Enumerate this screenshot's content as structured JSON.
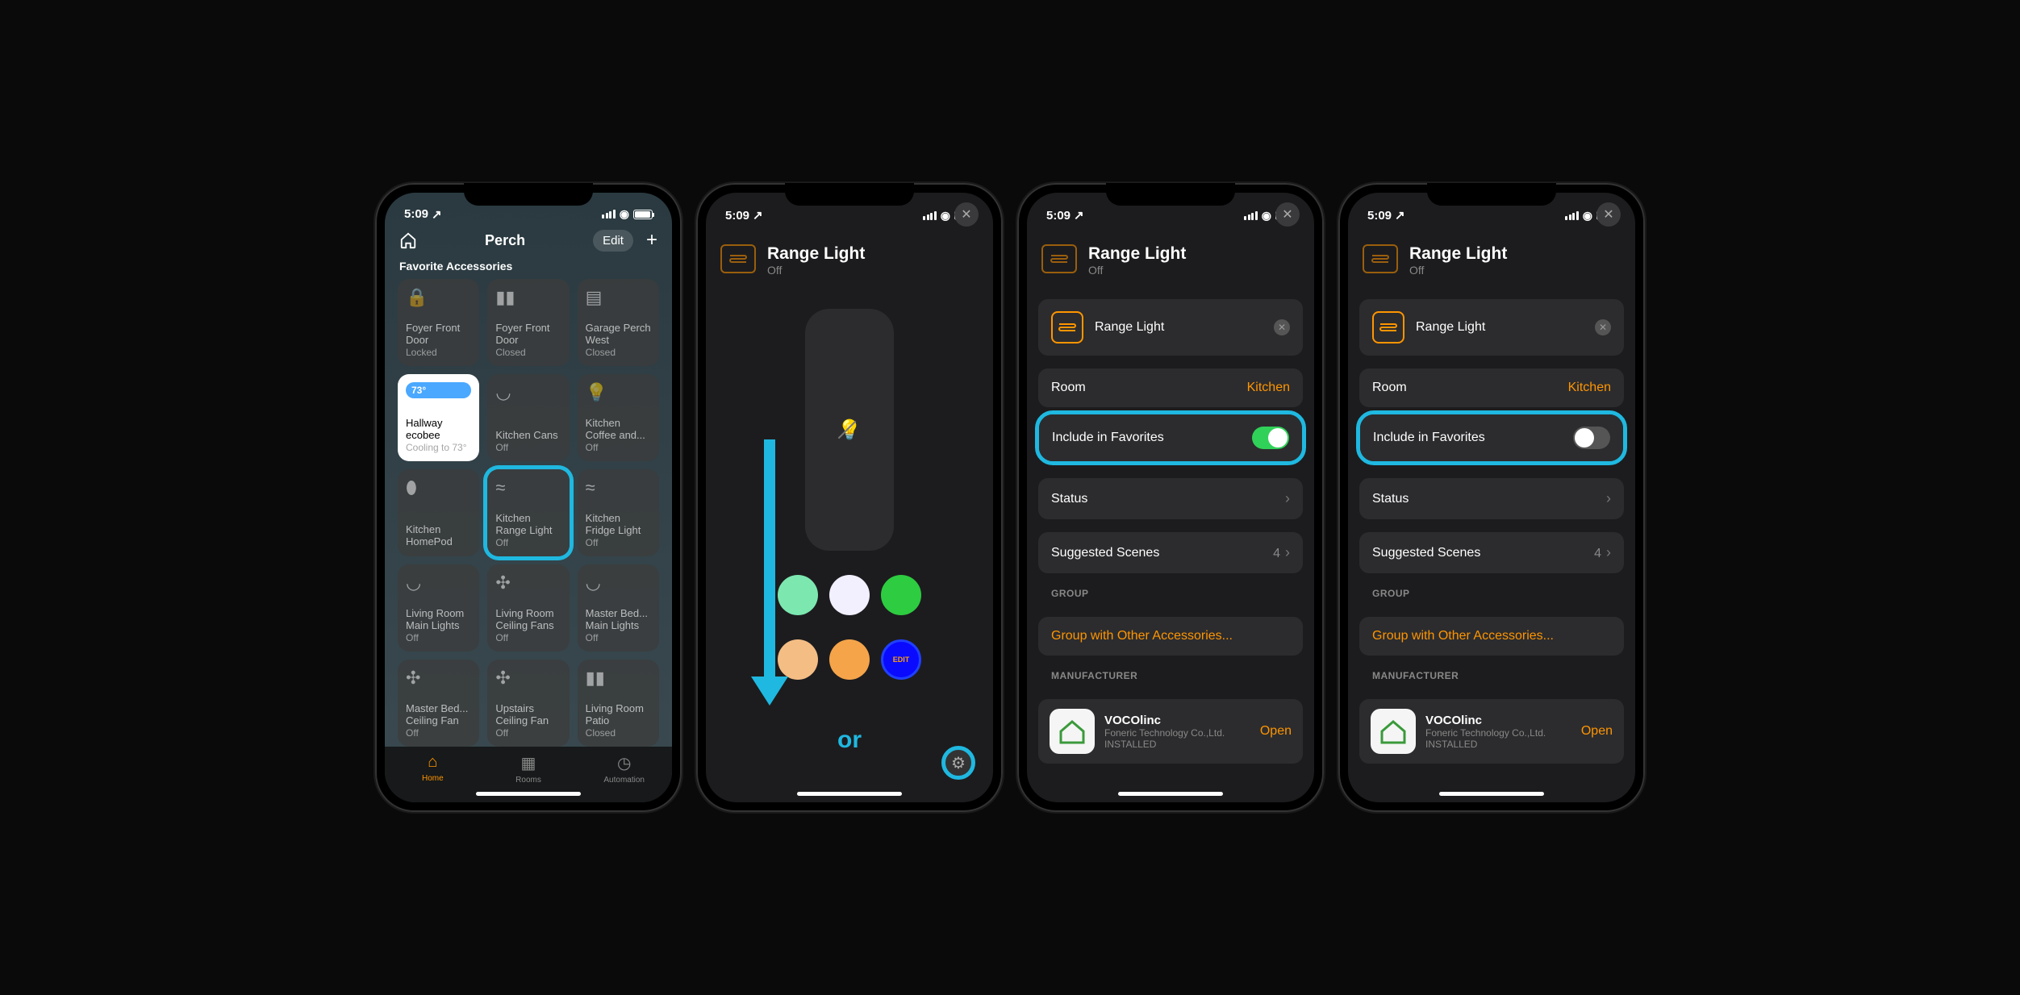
{
  "status": {
    "time": "5:09",
    "locationArrow": "↗"
  },
  "screen1": {
    "navTitle": "Perch",
    "editLabel": "Edit",
    "sectionTitle": "Favorite Accessories",
    "tiles": [
      {
        "name": "Foyer Front Door",
        "state": "Locked",
        "icon": "lock"
      },
      {
        "name": "Foyer Front Door",
        "state": "Closed",
        "icon": "sensor"
      },
      {
        "name": "Garage Perch West",
        "state": "Closed",
        "icon": "garage"
      },
      {
        "name": "Hallway ecobee",
        "state": "Cooling to 73°",
        "icon": "temp",
        "badge": "73°",
        "active": true
      },
      {
        "name": "Kitchen Cans",
        "state": "Off",
        "icon": "can"
      },
      {
        "name": "Kitchen Coffee and...",
        "state": "Off",
        "icon": "lamp"
      },
      {
        "name": "Kitchen HomePod",
        "state": "",
        "icon": "homepod"
      },
      {
        "name": "Kitchen Range Light",
        "state": "Off",
        "icon": "range",
        "highlighted": true
      },
      {
        "name": "Kitchen Fridge Light",
        "state": "Off",
        "icon": "range"
      },
      {
        "name": "Living Room Main Lights",
        "state": "Off",
        "icon": "can"
      },
      {
        "name": "Living Room Ceiling Fans",
        "state": "Off",
        "icon": "fan"
      },
      {
        "name": "Master Bed... Main Lights",
        "state": "Off",
        "icon": "can"
      },
      {
        "name": "Master Bed... Ceiling Fan",
        "state": "Off",
        "icon": "fan"
      },
      {
        "name": "Upstairs Ceiling Fan",
        "state": "Off",
        "icon": "fan"
      },
      {
        "name": "Living Room Patio",
        "state": "Closed",
        "icon": "sensor"
      }
    ],
    "tabs": {
      "home": "Home",
      "rooms": "Rooms",
      "automation": "Automation"
    }
  },
  "screen2": {
    "title": "Range Light",
    "subtitle": "Off",
    "editBtn": "EDIT",
    "orText": "or"
  },
  "settings": {
    "title": "Range Light",
    "subtitle": "Off",
    "nameField": "Range Light",
    "roomLabel": "Room",
    "roomValue": "Kitchen",
    "favLabel": "Include in Favorites",
    "statusLabel": "Status",
    "scenesLabel": "Suggested Scenes",
    "scenesCount": "4",
    "groupHeader": "GROUP",
    "groupLink": "Group with Other Accessories...",
    "mfrHeader": "MANUFACTURER",
    "mfrName": "VOCOlinc",
    "mfrCompany": "Foneric Technology Co.,Ltd.",
    "mfrInstalled": "INSTALLED",
    "openLabel": "Open"
  }
}
